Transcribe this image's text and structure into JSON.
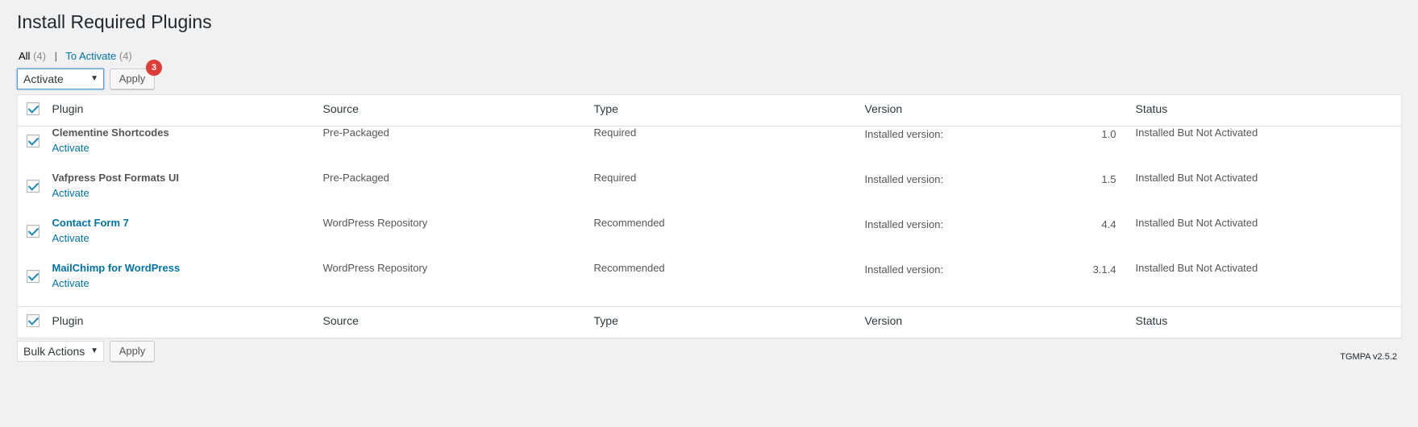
{
  "page": {
    "title": "Install Required Plugins"
  },
  "filters": {
    "all_label": "All",
    "all_count": "(4)",
    "separator": "|",
    "to_activate_label": "To Activate",
    "to_activate_count": "(4)"
  },
  "bulk_top": {
    "selected": "Activate",
    "apply": "Apply",
    "badge": "3"
  },
  "bulk_bottom": {
    "selected": "Bulk Actions",
    "apply": "Apply"
  },
  "table": {
    "headers": {
      "plugin": "Plugin",
      "source": "Source",
      "type": "Type",
      "version": "Version",
      "status": "Status"
    },
    "rows": [
      {
        "name": "Clementine Shortcodes",
        "action": "Activate",
        "source": "Pre-Packaged",
        "type": "Required",
        "version_label": "Installed version:",
        "version": "1.0",
        "status": "Installed But Not Activated"
      },
      {
        "name": "Vafpress Post Formats UI",
        "action": "Activate",
        "source": "Pre-Packaged",
        "type": "Required",
        "version_label": "Installed version:",
        "version": "1.5",
        "status": "Installed But Not Activated"
      },
      {
        "name": "Contact Form 7",
        "action": "Activate",
        "source": "WordPress Repository",
        "type": "Recommended",
        "version_label": "Installed version:",
        "version": "4.4",
        "status": "Installed But Not Activated"
      },
      {
        "name": "MailChimp for WordPress",
        "action": "Activate",
        "source": "WordPress Repository",
        "type": "Recommended",
        "version_label": "Installed version:",
        "version": "3.1.4",
        "status": "Installed But Not Activated"
      }
    ]
  },
  "footer": {
    "version_text": "TGMPA v2.5.2"
  },
  "colors": {
    "link": "#0073aa",
    "badge": "#dd3d36",
    "checkbox": "#1e8cbe"
  }
}
